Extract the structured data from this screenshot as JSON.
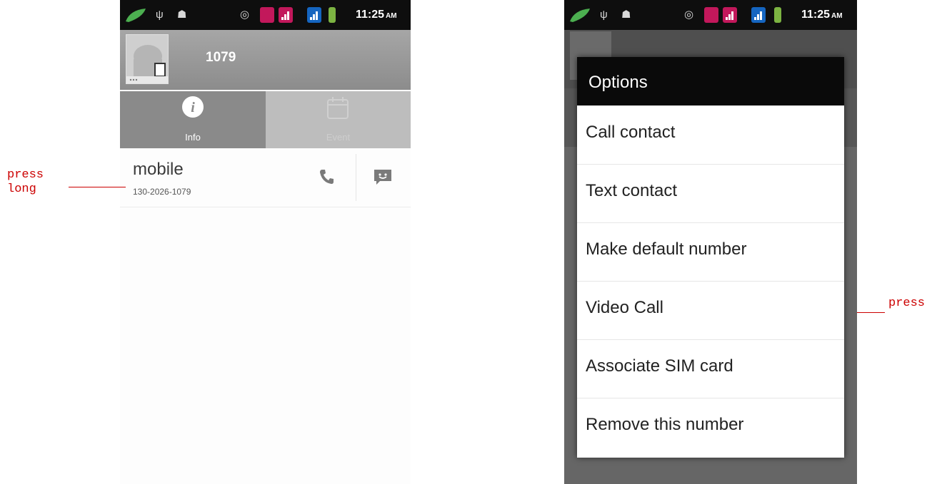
{
  "status_bar": {
    "time": "11:25",
    "ampm": "AM"
  },
  "left_screen": {
    "contact_name": "1079",
    "tabs": [
      {
        "label": "Info",
        "selected": true
      },
      {
        "label": "Event",
        "selected": false
      }
    ],
    "phone_entry": {
      "type": "mobile",
      "number": "130-2026-1079"
    }
  },
  "right_screen": {
    "dialog_title": "Options",
    "options": [
      "Call contact",
      "Text contact",
      "Make default number",
      "Video Call",
      "Associate SIM card",
      "Remove this number"
    ]
  },
  "annotations": {
    "left_line1": "press",
    "left_line2": "long",
    "right": "press"
  },
  "colors": {
    "annotation": "#cc0000",
    "status_bar": "#0e0e0e",
    "sim1": "#c2185b",
    "sim2": "#1565c0",
    "battery": "#7cb342"
  }
}
